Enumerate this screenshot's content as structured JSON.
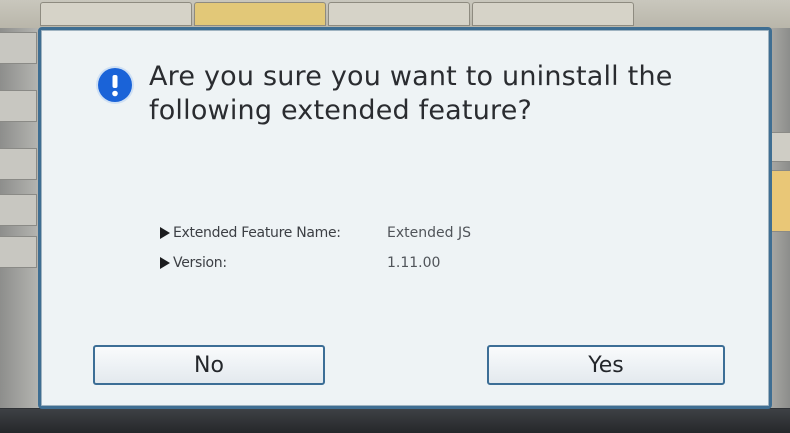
{
  "dialog": {
    "message": "Are you sure you want to uninstall the following extended feature?",
    "details": [
      {
        "label": "Extended Feature Name:",
        "value": "Extended JS"
      },
      {
        "label": "Version:",
        "value": "1.11.00"
      }
    ],
    "buttons": {
      "no": "No",
      "yes": "Yes"
    },
    "icon": "exclamation-info-icon"
  },
  "colors": {
    "dialog_border": "#3f6e92",
    "dialog_background": "#eef3f5",
    "icon_blue": "#1a63d8",
    "text": "#2a2c30"
  }
}
